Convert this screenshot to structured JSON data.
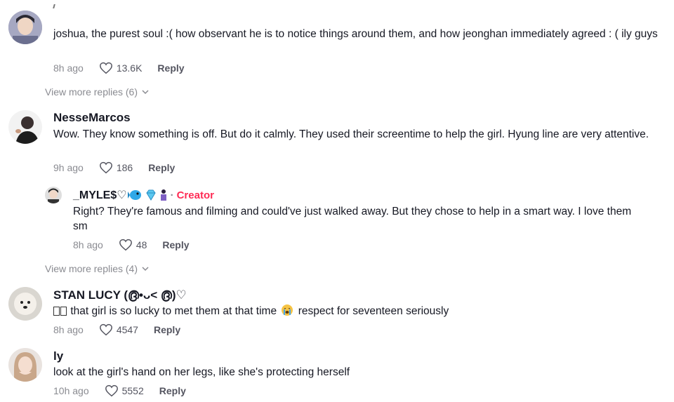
{
  "comments": [
    {
      "text": "joshua, the purest soul :( how observant he is to notice things around them, and how jeonghan immediately agreed : ( ily guys",
      "time": "8h ago",
      "likes": "13.6K",
      "reply_label": "Reply",
      "avatar_icon": "user-avatar-icon"
    },
    {
      "username": "NesseMarcos",
      "text": "Wow. They know something is off. But do it calmly. They used their screentime to help the girl. Hyung line are very attentive.",
      "time": "9h ago",
      "likes": "186",
      "reply_label": "Reply"
    },
    {
      "username": "STAN LUCY (൫•ᴗ< ൫)♡",
      "text": "that girl is so lucky to met them at that time",
      "text_after": "respect for seventeen seriously",
      "time": "8h ago",
      "likes": "4547",
      "reply_label": "Reply"
    },
    {
      "username": "ly",
      "text": "look at the girl's hand on her legs, like she's protecting herself",
      "time": "10h ago",
      "likes": "5552",
      "reply_label": "Reply"
    }
  ],
  "reply": {
    "username": "_MYLE$♡",
    "creator_label": "Creator",
    "separator": "·",
    "text": "Right? They're famous and filming and could've just walked away. But they chose to help in a smart way. I love them sm",
    "time": "8h ago",
    "likes": "48",
    "reply_label": "Reply"
  },
  "view_more": [
    {
      "label": "View more replies (6)"
    },
    {
      "label": "View more replies (4)"
    }
  ],
  "colors": {
    "creator": "#fe2c55",
    "meta": "#8a8b91",
    "text": "#161823"
  }
}
